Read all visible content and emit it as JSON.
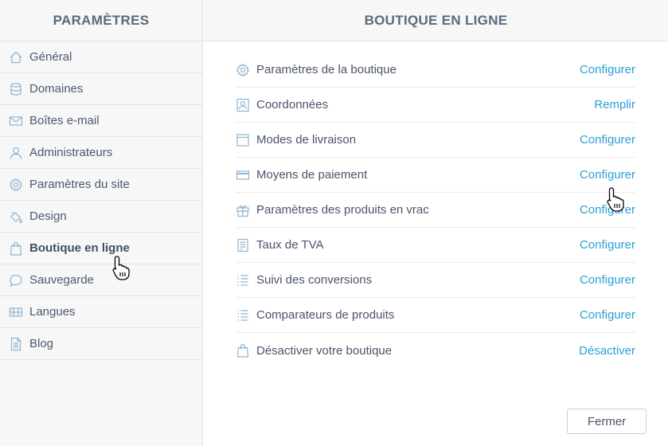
{
  "sidebar": {
    "title": "PARAMÈTRES",
    "items": [
      {
        "label": "Général",
        "icon": "home-icon"
      },
      {
        "label": "Domaines",
        "icon": "database-icon"
      },
      {
        "label": "Boîtes e-mail",
        "icon": "mail-icon"
      },
      {
        "label": "Administrateurs",
        "icon": "user-icon"
      },
      {
        "label": "Paramètres du site",
        "icon": "gear-icon"
      },
      {
        "label": "Design",
        "icon": "paint-bucket-icon"
      },
      {
        "label": "Boutique en ligne",
        "icon": "shopping-bag-icon",
        "active": true
      },
      {
        "label": "Sauvegarde",
        "icon": "chat-bubble-icon"
      },
      {
        "label": "Langues",
        "icon": "flags-icon"
      },
      {
        "label": "Blog",
        "icon": "document-icon"
      }
    ]
  },
  "main": {
    "title": "BOUTIQUE EN LIGNE",
    "rows": [
      {
        "label": "Paramètres de la boutique",
        "action": "Configurer",
        "icon": "gear-icon"
      },
      {
        "label": "Coordonnées",
        "action": "Remplir",
        "icon": "contact-card-icon"
      },
      {
        "label": "Modes de livraison",
        "action": "Configurer",
        "icon": "box-icon"
      },
      {
        "label": "Moyens de paiement",
        "action": "Configurer",
        "icon": "credit-card-icon"
      },
      {
        "label": "Paramètres des produits en vrac",
        "action": "Configurer",
        "icon": "gift-icon"
      },
      {
        "label": "Taux de TVA",
        "action": "Configurer",
        "icon": "receipt-icon"
      },
      {
        "label": "Suivi des conversions",
        "action": "Configurer",
        "icon": "list-icon"
      },
      {
        "label": "Comparateurs de produits",
        "action": "Configurer",
        "icon": "list-icon"
      },
      {
        "label": "Désactiver votre boutique",
        "action": "Désactiver",
        "icon": "shopping-bag-icon"
      }
    ],
    "close_label": "Fermer"
  },
  "colors": {
    "accent": "#2a9fd8",
    "icon": "#8fb3d1",
    "text": "#4a5568"
  }
}
